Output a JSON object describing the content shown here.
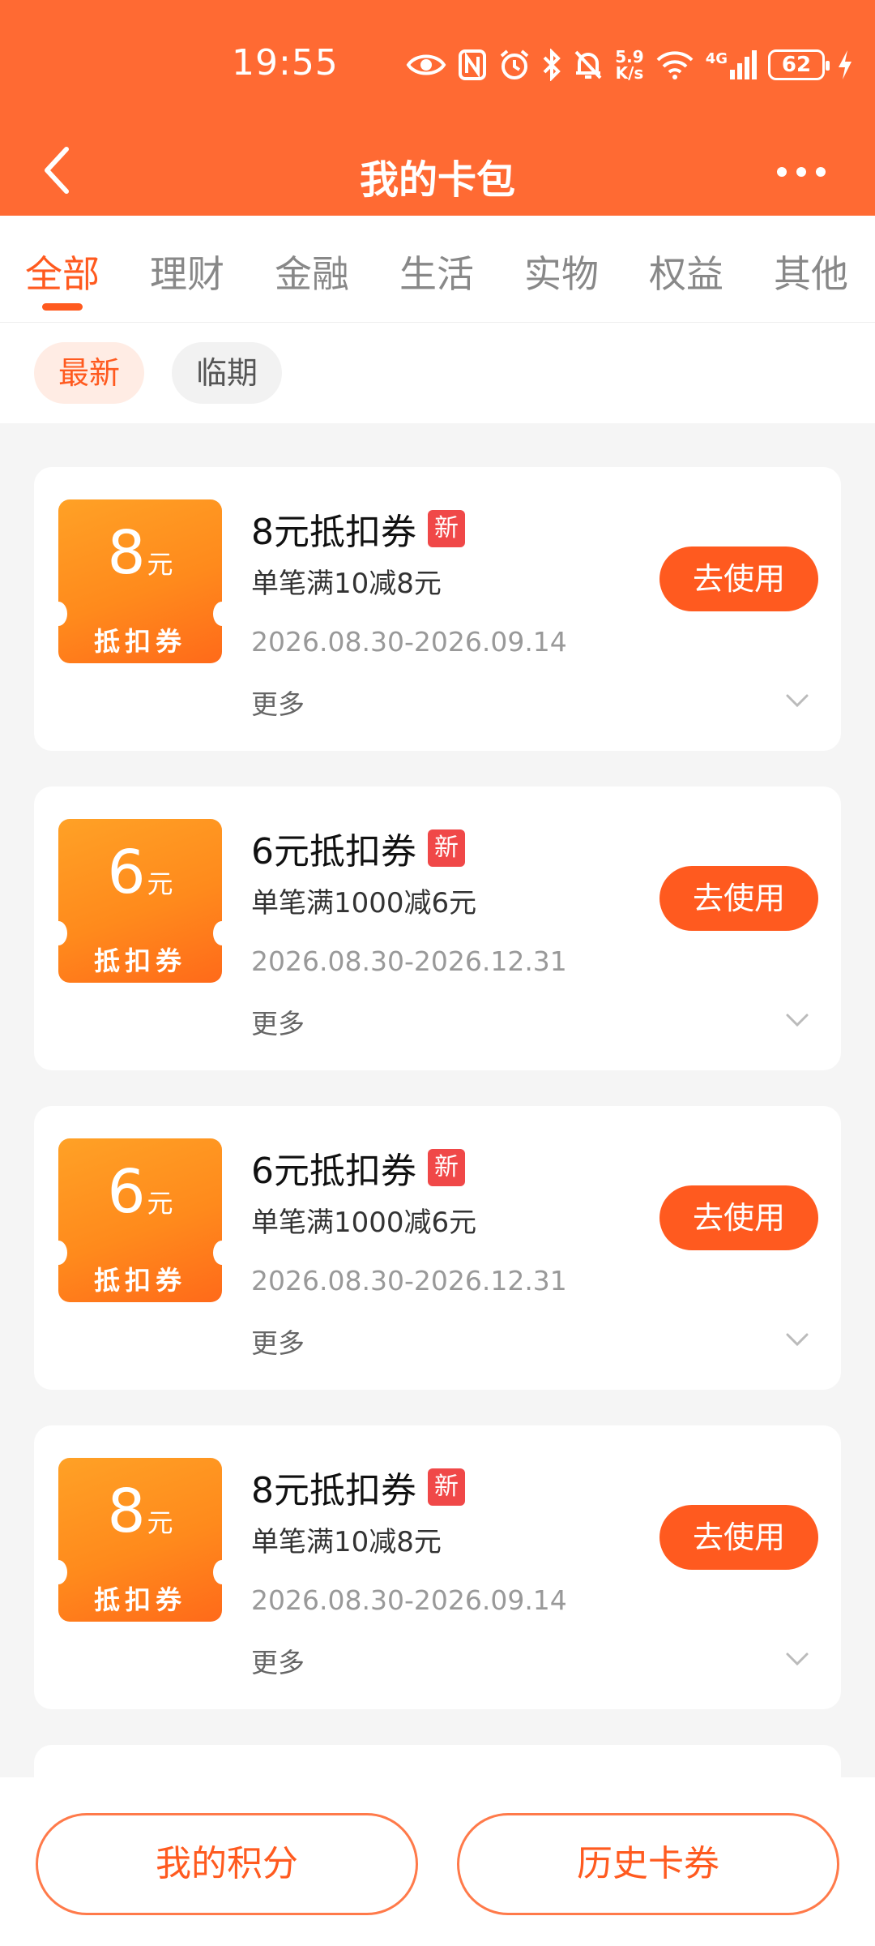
{
  "status_bar": {
    "time": "19:55",
    "net_speed_value": "5.9",
    "net_speed_unit": "K/s",
    "signal_label": "4G",
    "battery": "62",
    "icons": [
      "eye-icon",
      "nfc-icon",
      "alarm-icon",
      "bluetooth-icon",
      "mute-bell-icon",
      "wifi-icon",
      "cellular-signal-icon",
      "battery-icon",
      "charging-bolt-icon"
    ]
  },
  "header": {
    "title": "我的卡包",
    "back_icon": "chevron-left-icon",
    "more_icon": "more-dots-icon"
  },
  "tabs": [
    {
      "label": "全部",
      "active": true
    },
    {
      "label": "理财",
      "active": false
    },
    {
      "label": "金融",
      "active": false
    },
    {
      "label": "生活",
      "active": false
    },
    {
      "label": "实物",
      "active": false
    },
    {
      "label": "权益",
      "active": false
    },
    {
      "label": "其他",
      "active": false
    }
  ],
  "filters": [
    {
      "label": "最新",
      "active": true
    },
    {
      "label": "临期",
      "active": false
    }
  ],
  "coupons": [
    {
      "amount": "8",
      "unit": "元",
      "ticket_type": "抵扣券",
      "name": "8元抵扣券",
      "badge": "新",
      "rule": "单笔满10减8元",
      "date": "2026.08.30-2026.09.14",
      "more": "更多",
      "button": "去使用"
    },
    {
      "amount": "6",
      "unit": "元",
      "ticket_type": "抵扣券",
      "name": "6元抵扣券",
      "badge": "新",
      "rule": "单笔满1000减6元",
      "date": "2026.08.30-2026.12.31",
      "more": "更多",
      "button": "去使用"
    },
    {
      "amount": "6",
      "unit": "元",
      "ticket_type": "抵扣券",
      "name": "6元抵扣券",
      "badge": "新",
      "rule": "单笔满1000减6元",
      "date": "2026.08.30-2026.12.31",
      "more": "更多",
      "button": "去使用"
    },
    {
      "amount": "8",
      "unit": "元",
      "ticket_type": "抵扣券",
      "name": "8元抵扣券",
      "badge": "新",
      "rule": "单笔满10减8元",
      "date": "2026.08.30-2026.09.14",
      "more": "更多",
      "button": "去使用"
    }
  ],
  "bottom": {
    "points_button": "我的积分",
    "history_button": "历史卡券"
  },
  "colors": {
    "header_bg": "#ff6a33",
    "accent": "#ff5a1f",
    "badge": "#f04848",
    "ticket_gradient_start": "#ffa126",
    "ticket_gradient_end": "#ff6a1a"
  }
}
